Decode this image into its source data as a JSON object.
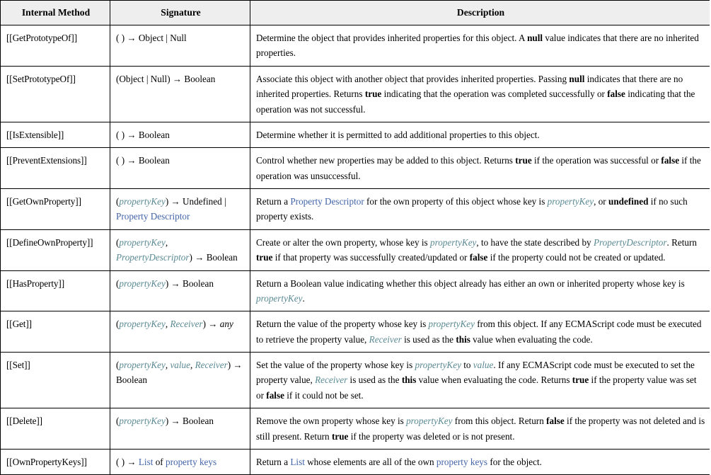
{
  "table": {
    "headers": [
      {
        "id": "internal-method",
        "label": "Internal Method"
      },
      {
        "id": "signature",
        "label": "Signature"
      },
      {
        "id": "description",
        "label": "Description"
      }
    ],
    "colors": {
      "header_background": "#eeeeee",
      "border": "#000000",
      "variable_token": "#5b8a93",
      "link_token": "#4364a8",
      "text": "#000000"
    },
    "rows": [
      {
        "method": "[[GetPrototypeOf]]",
        "signature_html": "( ) <span class=\"arrow\">→</span> Object | Null",
        "signature_text": "( ) → Object | Null",
        "description_html": "Determine the object that provides inherited properties for this object. A <span class=\"kw\">null</span> value indicates that there are no inherited properties.",
        "description_text": "Determine the object that provides inherited properties for this object. A null value indicates that there are no inherited properties."
      },
      {
        "method": "[[SetPrototypeOf]]",
        "signature_html": "(Object | Null) <span class=\"arrow\">→</span> Boolean",
        "signature_text": "(Object | Null) → Boolean",
        "description_html": "Associate this object with another object that provides inherited properties. Passing <span class=\"kw\">null</span> indicates that there are no inherited properties. Returns <span class=\"kw\">true</span> indicating that the operation was completed successfully or <span class=\"kw\">false</span> indicating that the operation was not successful.",
        "description_text": "Associate this object with another object that provides inherited properties. Passing null indicates that there are no inherited properties. Returns true indicating that the operation was completed successfully or false indicating that the operation was not successful."
      },
      {
        "method": "[[IsExtensible]]",
        "signature_html": "( ) <span class=\"arrow\">→</span> Boolean",
        "signature_text": "( ) → Boolean",
        "description_html": "Determine whether it is permitted to add additional properties to this object.",
        "description_text": "Determine whether it is permitted to add additional properties to this object."
      },
      {
        "method": "[[PreventExtensions]]",
        "signature_html": "( ) <span class=\"arrow\">→</span> Boolean",
        "signature_text": "( ) → Boolean",
        "description_html": "Control whether new properties may be added to this object. Returns <span class=\"kw\">true</span> if the operation was successful or <span class=\"kw\">false</span> if the operation was unsuccessful.",
        "description_text": "Control whether new properties may be added to this object. Returns true if the operation was successful or false if the operation was unsuccessful."
      },
      {
        "method": "[[GetOwnProperty]]",
        "signature_html": "(<span class=\"var\">propertyKey</span>) <span class=\"arrow\">→</span> Undefined | <span class=\"lnk\">Property Descriptor</span>",
        "signature_text": "(propertyKey) → Undefined | Property Descriptor",
        "description_html": "Return a <span class=\"lnk\">Property Descriptor</span> for the own property of this object whose key is <span class=\"var\">propertyKey</span>, or <span class=\"kw\">undefined</span> if no such property exists.",
        "description_text": "Return a Property Descriptor for the own property of this object whose key is propertyKey, or undefined if no such property exists."
      },
      {
        "method": "[[DefineOwnProperty]]",
        "signature_html": "(<span class=\"var\">propertyKey</span>, <span class=\"var\">PropertyDescriptor</span>) <span class=\"arrow\">→</span> Boolean",
        "signature_text": "(propertyKey, PropertyDescriptor) → Boolean",
        "description_html": "Create or alter the own property, whose key is <span class=\"var\">propertyKey</span>, to have the state described by <span class=\"var\">PropertyDescriptor</span>. Return <span class=\"kw\">true</span> if that property was successfully created/updated or <span class=\"kw\">false</span> if the property could not be created or updated.",
        "description_text": "Create or alter the own property, whose key is propertyKey, to have the state described by PropertyDescriptor. Return true if that property was successfully created/updated or false if the property could not be created or updated."
      },
      {
        "method": "[[HasProperty]]",
        "signature_html": "(<span class=\"var\">propertyKey</span>) <span class=\"arrow\">→</span> Boolean",
        "signature_text": "(propertyKey) → Boolean",
        "description_html": "Return a Boolean value indicating whether this object already has either an own or inherited property whose key is <span class=\"var\">propertyKey</span>.",
        "description_text": "Return a Boolean value indicating whether this object already has either an own or inherited property whose key is propertyKey."
      },
      {
        "method": "[[Get]]",
        "signature_html": "(<span class=\"var\">propertyKey</span>, <span class=\"var\">Receiver</span>) <span class=\"arrow\">→</span> <span class=\"it\">any</span>",
        "signature_text": "(propertyKey, Receiver) → any",
        "description_html": "Return the value of the property whose key is <span class=\"var\">propertyKey</span> from this object. If any ECMAScript code must be executed to retrieve the property value, <span class=\"var\">Receiver</span> is used as the <span class=\"kw\">this</span> value when evaluating the code.",
        "description_text": "Return the value of the property whose key is propertyKey from this object. If any ECMAScript code must be executed to retrieve the property value, Receiver is used as the this value when evaluating the code."
      },
      {
        "method": "[[Set]]",
        "signature_html": "(<span class=\"var\">propertyKey</span>, <span class=\"var\">value</span>, <span class=\"var\">Receiver</span>) <span class=\"arrow\">→</span> Boolean",
        "signature_text": "(propertyKey, value, Receiver) → Boolean",
        "description_html": "Set the value of the property whose key is <span class=\"var\">propertyKey</span> to <span class=\"var\">value</span>. If any ECMAScript code must be executed to set the property value, <span class=\"var\">Receiver</span> is used as the <span class=\"kw\">this</span> value when evaluating the code. Returns <span class=\"kw\">true</span> if the property value was set or <span class=\"kw\">false</span> if it could not be set.",
        "description_text": "Set the value of the property whose key is propertyKey to value. If any ECMAScript code must be executed to set the property value, Receiver is used as the this value when evaluating the code. Returns true if the property value was set or false if it could not be set."
      },
      {
        "method": "[[Delete]]",
        "signature_html": "(<span class=\"var\">propertyKey</span>) <span class=\"arrow\">→</span> Boolean",
        "signature_text": "(propertyKey) → Boolean",
        "description_html": "Remove the own property whose key is <span class=\"var\">propertyKey</span> from this object. Return <span class=\"kw\">false</span> if the property was not deleted and is still present. Return <span class=\"kw\">true</span> if the property was deleted or is not present.",
        "description_text": "Remove the own property whose key is propertyKey from this object. Return false if the property was not deleted and is still present. Return true if the property was deleted or is not present."
      },
      {
        "method": "[[OwnPropertyKeys]]",
        "signature_html": "( ) <span class=\"arrow\">→</span> <span class=\"lnk\">List</span> of <span class=\"lnk\">property keys</span>",
        "signature_text": "( ) → List of property keys",
        "description_html": "Return a <span class=\"lnk\">List</span> whose elements are all of the own <span class=\"lnk\">property keys</span> for the object.",
        "description_text": "Return a List whose elements are all of the own property keys for the object."
      }
    ]
  }
}
